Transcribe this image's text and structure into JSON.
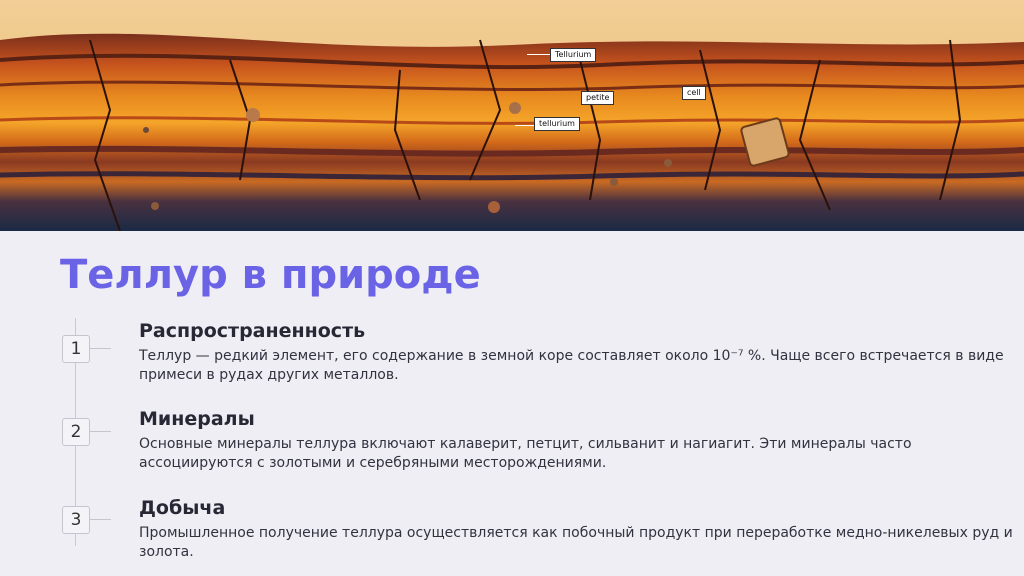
{
  "image": {
    "labels": [
      "Tellurium",
      "petite",
      "tellurium",
      "cell"
    ]
  },
  "slide": {
    "title": "Теллур в природе",
    "items": [
      {
        "number": "1",
        "title": "Распространенность",
        "text": "Теллур — редкий элемент, его содержание в земной коре составляет около 10⁻⁷ %. Чаще всего встречается в виде примеси в рудах других металлов."
      },
      {
        "number": "2",
        "title": "Минералы",
        "text": "Основные минералы теллура включают калаверит, петцит, сильванит и нагиагит. Эти минералы часто ассоциируются с золотыми и серебряными месторождениями."
      },
      {
        "number": "3",
        "title": "Добыча",
        "text": "Промышленное получение теллура осуществляется как побочный продукт при переработке медно-никелевых руд и золота."
      }
    ]
  },
  "colors": {
    "title": "#6b63e6",
    "background": "#eeeef4"
  }
}
